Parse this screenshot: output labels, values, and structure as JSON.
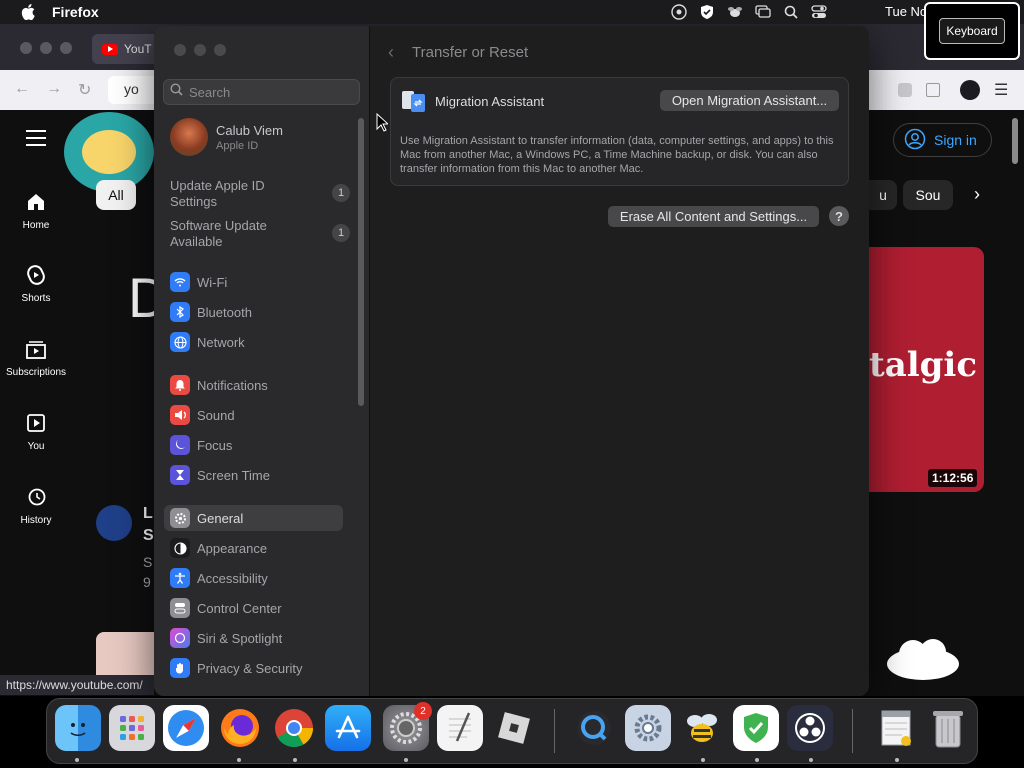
{
  "menubar": {
    "app_name": "Firefox",
    "clock": "Tue No",
    "keyboard_tooltip": "Keyboard"
  },
  "firefox": {
    "tab_label": "YouT",
    "url_fragment": "yo",
    "status_url": "https://www.youtube.com/"
  },
  "youtube": {
    "nav": [
      {
        "label": "Home"
      },
      {
        "label": "Shorts"
      },
      {
        "label": "Subscriptions"
      },
      {
        "label": "You"
      },
      {
        "label": "History"
      }
    ],
    "chip_all": "All",
    "chip_right1": "u",
    "chip_right2": "Sou",
    "sign_in": "Sign in",
    "thumb_text": "talgic",
    "duration": "1:12:56",
    "big_letter": "D",
    "trunc_l1": "L",
    "trunc_l2": "S",
    "trunc_l3": "S",
    "trunc_l4": "9"
  },
  "settings": {
    "search_placeholder": "Search",
    "account": {
      "name": "Calub Viem",
      "subtitle": "Apple ID"
    },
    "notices": [
      {
        "label": "Update Apple ID Settings",
        "badge": "1"
      },
      {
        "label": "Software Update Available",
        "badge": "1"
      }
    ],
    "sidebar_items": [
      {
        "label": "Wi-Fi",
        "icon": "wifi-icon",
        "color": "#2f7cf6"
      },
      {
        "label": "Bluetooth",
        "icon": "bluetooth-icon",
        "color": "#2f7cf6"
      },
      {
        "label": "Network",
        "icon": "globe-icon",
        "color": "#2f7cf6"
      },
      {
        "label": "Notifications",
        "icon": "bell-icon",
        "color": "#ea4a43"
      },
      {
        "label": "Sound",
        "icon": "speaker-icon",
        "color": "#ea4a43"
      },
      {
        "label": "Focus",
        "icon": "moon-icon",
        "color": "#5c54d8"
      },
      {
        "label": "Screen Time",
        "icon": "hourglass-icon",
        "color": "#5c54d8"
      },
      {
        "label": "General",
        "icon": "gear-icon",
        "color": "#8e8e93"
      },
      {
        "label": "Appearance",
        "icon": "appearance-icon",
        "color": "#1c1c1e"
      },
      {
        "label": "Accessibility",
        "icon": "accessibility-icon",
        "color": "#2f7cf6"
      },
      {
        "label": "Control Center",
        "icon": "control-center-icon",
        "color": "#8e8e93"
      },
      {
        "label": "Siri & Spotlight",
        "icon": "siri-icon",
        "color": "#b03ad8"
      },
      {
        "label": "Privacy & Security",
        "icon": "hand-icon",
        "color": "#2f7cf6"
      }
    ],
    "header_title": "Transfer or Reset",
    "migration": {
      "title": "Migration Assistant",
      "button": "Open Migration Assistant...",
      "description": "Use Migration Assistant to transfer information (data, computer settings, and apps) to this Mac from another Mac, a Windows PC, a Time Machine backup, or disk. You can also transfer information from this Mac to another Mac."
    },
    "erase_button": "Erase All Content and Settings...",
    "help_label": "?"
  },
  "dock": {
    "items": [
      {
        "name": "finder-icon",
        "color": "#3aa0f0"
      },
      {
        "name": "launchpad-icon",
        "color": "#d8d8dc"
      },
      {
        "name": "safari-icon",
        "color": "#2f8cf0"
      },
      {
        "name": "firefox-icon",
        "color": "#ff7a1a"
      },
      {
        "name": "chrome-icon",
        "color": "#f2f2f2"
      },
      {
        "name": "app-store-icon",
        "color": "#1c8ef2"
      },
      {
        "name": "system-settings-icon",
        "color": "#8e8e93"
      },
      {
        "name": "textedit-icon",
        "color": "#f4f4f4"
      },
      {
        "name": "roblox-icon",
        "color": "#d8d8d8"
      },
      {
        "name": "quicktime-icon",
        "color": "#2a2a2e"
      },
      {
        "name": "settings-gear-icon",
        "color": "#c8d4e4"
      },
      {
        "name": "bee-icon",
        "color": "#f0c020"
      },
      {
        "name": "adguard-icon",
        "color": "#3fb34f"
      },
      {
        "name": "obs-icon",
        "color": "#2a2d3e"
      },
      {
        "name": "preview-icon",
        "color": "#9aa0a8"
      },
      {
        "name": "trash-icon",
        "color": "#a8a8ac"
      }
    ],
    "settings_badge": "2"
  }
}
